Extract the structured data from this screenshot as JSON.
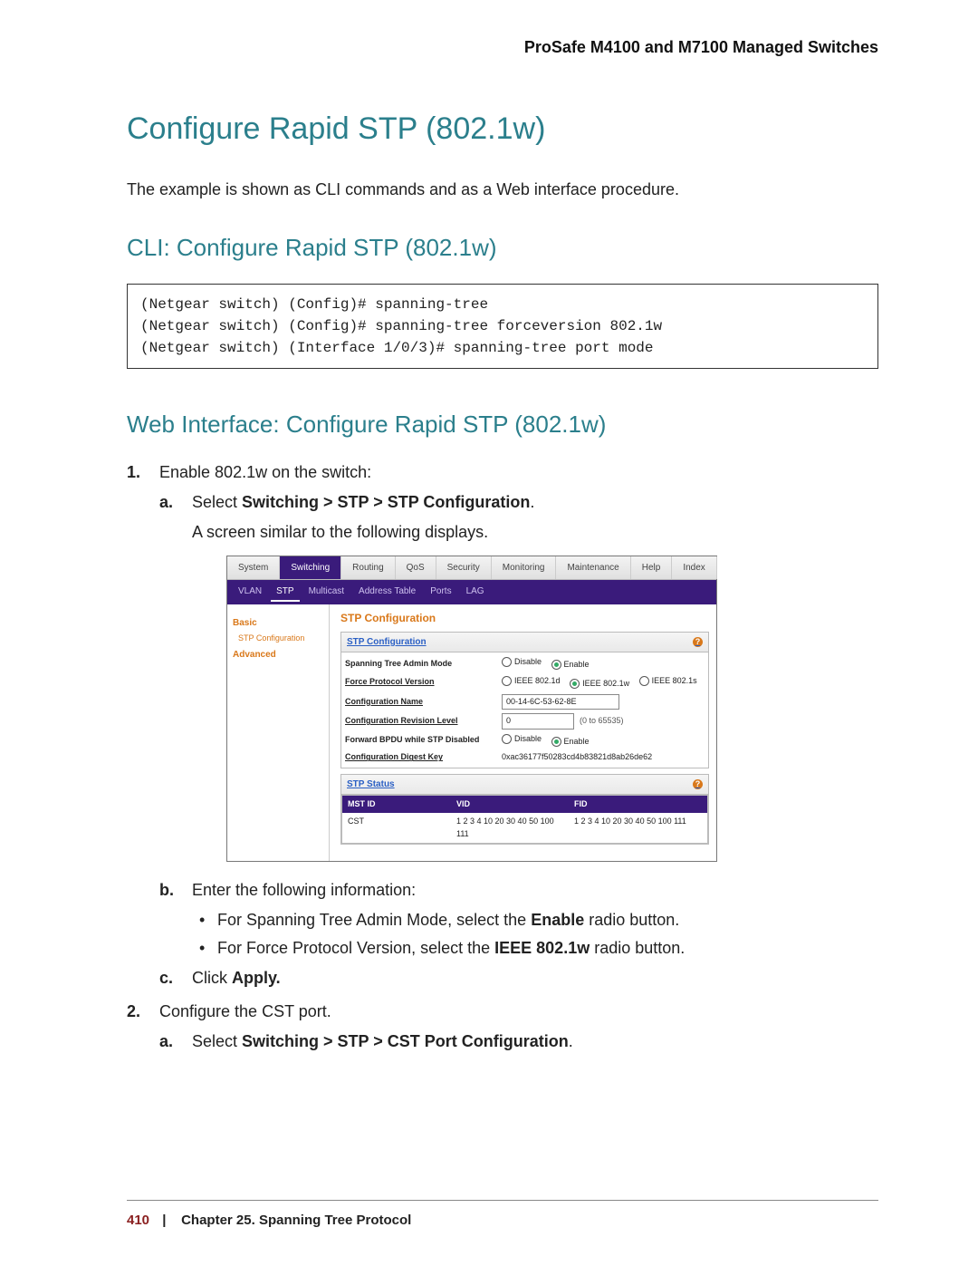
{
  "doc_header": "ProSafe M4100 and M7100 Managed Switches",
  "title": "Configure Rapid STP (802.1w)",
  "intro": "The example is shown as CLI commands and as a Web interface procedure.",
  "section_cli_title": "CLI: Configure Rapid STP (802.1w)",
  "cli_block": "(Netgear switch) (Config)# spanning-tree\n(Netgear switch) (Config)# spanning-tree forceversion 802.1w\n(Netgear switch) (Interface 1/0/3)# spanning-tree port mode",
  "section_web_title": "Web Interface: Configure Rapid STP (802.1w)",
  "steps": {
    "s1": {
      "num": "1.",
      "text": "Enable 802.1w on the switch:",
      "a": {
        "label": "a.",
        "prefix": "Select ",
        "bold": "Switching > STP > STP Configuration",
        "suffix": ".",
        "after": "A screen similar to the following displays."
      },
      "b": {
        "label": "b.",
        "text": "Enter the following information:",
        "bullet1_prefix": "For Spanning Tree Admin Mode, select the ",
        "bullet1_bold": "Enable",
        "bullet1_suffix": " radio button.",
        "bullet2_prefix": "For Force Protocol Version, select the ",
        "bullet2_bold": "IEEE 802.1w",
        "bullet2_suffix": " radio button."
      },
      "c": {
        "label": "c.",
        "prefix": "Click ",
        "bold": "Apply."
      }
    },
    "s2": {
      "num": "2.",
      "text": "Configure the CST port.",
      "a": {
        "label": "a.",
        "prefix": "Select ",
        "bold": "Switching > STP > CST Port Configuration",
        "suffix": "."
      }
    }
  },
  "ui": {
    "tabs1": [
      "System",
      "Switching",
      "Routing",
      "QoS",
      "Security",
      "Monitoring",
      "Maintenance",
      "Help",
      "Index"
    ],
    "tabs1_active": 1,
    "tabs2": [
      "VLAN",
      "STP",
      "Multicast",
      "Address Table",
      "Ports",
      "LAG"
    ],
    "tabs2_active": 1,
    "sidebar": {
      "basic": "Basic",
      "item1": "STP Configuration",
      "advanced": "Advanced"
    },
    "main_title": "STP Configuration",
    "sec_config_title": "STP Configuration",
    "rows": {
      "admin_mode_label": "Spanning Tree Admin Mode",
      "admin_disable": "Disable",
      "admin_enable": "Enable",
      "force_label": "Force Protocol Version",
      "force_opt1": "IEEE 802.1d",
      "force_opt2": "IEEE 802.1w",
      "force_opt3": "IEEE 802.1s",
      "conf_name_label": "Configuration Name",
      "conf_name_value": "00-14-6C-53-62-8E",
      "rev_label": "Configuration Revision Level",
      "rev_value": "0",
      "rev_hint": "(0 to 65535)",
      "fwd_label": "Forward BPDU while STP Disabled",
      "fwd_disable": "Disable",
      "fwd_enable": "Enable",
      "digest_label": "Configuration Digest Key",
      "digest_value": "0xac36177f50283cd4b83821d8ab26de62"
    },
    "sec_status_title": "STP Status",
    "tbl": {
      "h1": "MST ID",
      "h2": "VID",
      "h3": "FID",
      "r1c1": "CST",
      "r1c2": "1 2 3 4 10 20 30 40 50 100 111",
      "r1c3": "1 2 3 4 10 20 30 40 50 100 111"
    }
  },
  "footer": {
    "page": "410",
    "sep": "|",
    "chapter": "Chapter 25.  Spanning Tree Protocol"
  }
}
